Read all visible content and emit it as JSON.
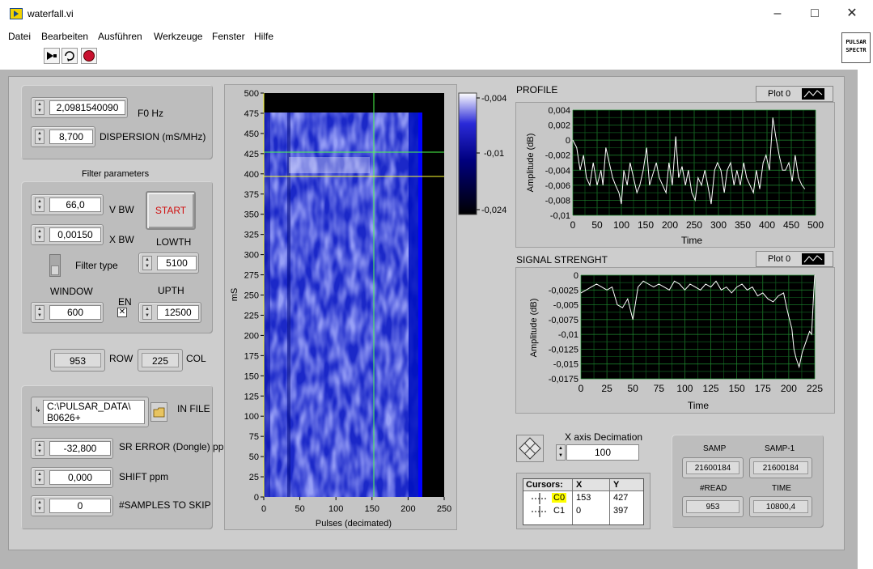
{
  "window": {
    "title": "waterfall.vi"
  },
  "menu": [
    "Datei",
    "Bearbeiten",
    "Ausführen",
    "Werkzeuge",
    "Fenster",
    "Hilfe"
  ],
  "vi_icon": {
    "line1": "PULSAR",
    "line2": "SPECTR"
  },
  "controls": {
    "f0": {
      "value": "2,0981540090",
      "label": "F0 Hz"
    },
    "dispersion": {
      "value": "8,700",
      "label": "DISPERSION (mS/MHz)"
    },
    "filter_title": "Filter parameters",
    "vbw": {
      "value": "66,0",
      "label": "V BW"
    },
    "xbw": {
      "value": "0,00150",
      "label": "X BW"
    },
    "start_button": "START",
    "lowth": {
      "label": "LOWTH",
      "value": "5100"
    },
    "filter_type_label": "Filter type",
    "window": {
      "label": "WINDOW",
      "value": "600"
    },
    "en_label": "EN",
    "upth": {
      "label": "UPTH",
      "value": "12500"
    },
    "row": {
      "value": "953",
      "label": "ROW"
    },
    "col": {
      "value": "225",
      "label": "COL"
    },
    "infile": {
      "line1": "C:\\PULSAR_DATA\\",
      "line2": "B0626+",
      "label": "IN FILE"
    },
    "sr_error": {
      "value": "-32,800",
      "label": "SR ERROR (Dongle) ppm"
    },
    "shift": {
      "value": "0,000",
      "label": "SHIFT ppm"
    },
    "skip": {
      "value": "0",
      "label": "#SAMPLES TO SKIP"
    }
  },
  "waterfall": {
    "ylabel": "mS",
    "xlabel": "Pulses (decimated)",
    "yticks": [
      "500",
      "475",
      "450",
      "425",
      "400",
      "375",
      "350",
      "325",
      "300",
      "275",
      "250",
      "225",
      "200",
      "175",
      "150",
      "125",
      "100",
      "75",
      "50",
      "25",
      "0"
    ],
    "xticks": [
      "0",
      "50",
      "100",
      "150",
      "200",
      "250"
    ],
    "scale": [
      "-0,004",
      "-0,01",
      "-0,024"
    ]
  },
  "profile": {
    "title": "PROFILE",
    "legend": "Plot 0",
    "xlabel": "Time",
    "ylabel": "Amplitude (dB)"
  },
  "signal": {
    "title": "SIGNAL STRENGHT",
    "legend": "Plot 0",
    "xlabel": "Time",
    "ylabel": "Amplitude (dB)"
  },
  "decimation": {
    "label": "X axis Decimation",
    "value": "100"
  },
  "cursors": {
    "header": [
      "Cursors:",
      "X",
      "Y"
    ],
    "rows": [
      {
        "name": "C0",
        "x": "153",
        "y": "427"
      },
      {
        "name": "C1",
        "x": "0",
        "y": "397"
      }
    ]
  },
  "samples": {
    "samp_label": "SAMP",
    "samp": "21600184",
    "samp1_label": "SAMP-1",
    "samp1": "21600184",
    "read_label": "#READ",
    "read": "953",
    "time_label": "TIME",
    "time": "10800,4"
  },
  "chart_data": [
    {
      "type": "line",
      "title": "PROFILE",
      "xlabel": "Time",
      "ylabel": "Amplitude (dB)",
      "xlim": [
        0,
        500
      ],
      "ylim": [
        -0.01,
        0.004
      ],
      "xticks": [
        "0",
        "50",
        "100",
        "150",
        "200",
        "250",
        "300",
        "350",
        "400",
        "450",
        "500"
      ],
      "yticks": [
        "0,004",
        "0,002",
        "0",
        "-0,002",
        "-0,004",
        "-0,006",
        "-0,008",
        "-0,01"
      ],
      "grid": true,
      "series": [
        {
          "name": "Plot 0",
          "x": [
            0,
            8,
            15,
            22,
            28,
            35,
            42,
            50,
            58,
            62,
            68,
            75,
            82,
            88,
            95,
            100,
            105,
            112,
            118,
            125,
            132,
            138,
            145,
            152,
            158,
            165,
            172,
            178,
            185,
            192,
            198,
            205,
            212,
            218,
            225,
            232,
            238,
            245,
            252,
            258,
            265,
            272,
            278,
            285,
            292,
            298,
            305,
            312,
            318,
            325,
            332,
            338,
            345,
            352,
            358,
            365,
            372,
            378,
            385,
            392,
            398,
            405,
            412,
            418,
            425,
            432,
            438,
            445,
            452,
            458,
            465,
            472,
            478
          ],
          "y": [
            0.0,
            -0.001,
            -0.004,
            -0.002,
            -0.005,
            -0.006,
            -0.003,
            -0.006,
            -0.004,
            -0.006,
            -0.001,
            -0.003,
            -0.005,
            -0.006,
            -0.007,
            -0.0085,
            -0.004,
            -0.006,
            -0.003,
            -0.005,
            -0.007,
            -0.006,
            -0.004,
            -0.001,
            -0.006,
            -0.0045,
            -0.003,
            -0.005,
            -0.006,
            -0.007,
            -0.003,
            -0.006,
            0.0005,
            -0.005,
            -0.0035,
            -0.006,
            -0.004,
            -0.007,
            -0.008,
            -0.005,
            -0.006,
            -0.004,
            -0.006,
            -0.0085,
            -0.004,
            -0.003,
            -0.004,
            -0.007,
            -0.004,
            -0.003,
            -0.006,
            -0.004,
            -0.006,
            -0.003,
            -0.005,
            -0.006,
            -0.007,
            -0.004,
            -0.0065,
            -0.003,
            -0.002,
            -0.004,
            0.003,
            0.0005,
            -0.002,
            -0.004,
            -0.004,
            -0.003,
            -0.0055,
            -0.002,
            -0.005,
            -0.006,
            -0.0065
          ]
        }
      ]
    },
    {
      "type": "line",
      "title": "SIGNAL STRENGHT",
      "xlabel": "Time",
      "ylabel": "Amplitude (dB)",
      "xlim": [
        0,
        225
      ],
      "ylim": [
        -0.0175,
        0
      ],
      "xticks": [
        "0",
        "25",
        "50",
        "75",
        "100",
        "125",
        "150",
        "175",
        "200",
        "225"
      ],
      "yticks": [
        "0",
        "-0,0025",
        "-0,005",
        "-0,0075",
        "-0,01",
        "-0,0125",
        "-0,015",
        "-0,0175"
      ],
      "grid": true,
      "series": [
        {
          "name": "Plot 0",
          "x": [
            0,
            5,
            10,
            15,
            20,
            25,
            30,
            35,
            40,
            45,
            50,
            55,
            60,
            65,
            70,
            75,
            80,
            85,
            90,
            95,
            100,
            105,
            110,
            115,
            120,
            125,
            130,
            135,
            140,
            145,
            150,
            155,
            160,
            165,
            170,
            175,
            180,
            185,
            190,
            195,
            198,
            200,
            203,
            205,
            207,
            210,
            213,
            215,
            218,
            220,
            222,
            224,
            225
          ],
          "y": [
            -0.003,
            -0.0025,
            -0.002,
            -0.0015,
            -0.002,
            -0.0025,
            -0.002,
            -0.005,
            -0.0055,
            -0.004,
            -0.0075,
            -0.002,
            -0.001,
            -0.0015,
            -0.002,
            -0.0015,
            -0.002,
            -0.0025,
            -0.001,
            -0.0015,
            -0.0025,
            -0.0015,
            -0.002,
            -0.0025,
            -0.0015,
            -0.002,
            -0.001,
            -0.0025,
            -0.002,
            -0.003,
            -0.002,
            -0.0015,
            -0.0025,
            -0.002,
            -0.0035,
            -0.003,
            -0.004,
            -0.0045,
            -0.0035,
            -0.003,
            -0.0055,
            -0.007,
            -0.009,
            -0.0125,
            -0.014,
            -0.0155,
            -0.013,
            -0.012,
            -0.0105,
            -0.0095,
            -0.01,
            -0.003,
            0.0
          ]
        }
      ]
    }
  ]
}
